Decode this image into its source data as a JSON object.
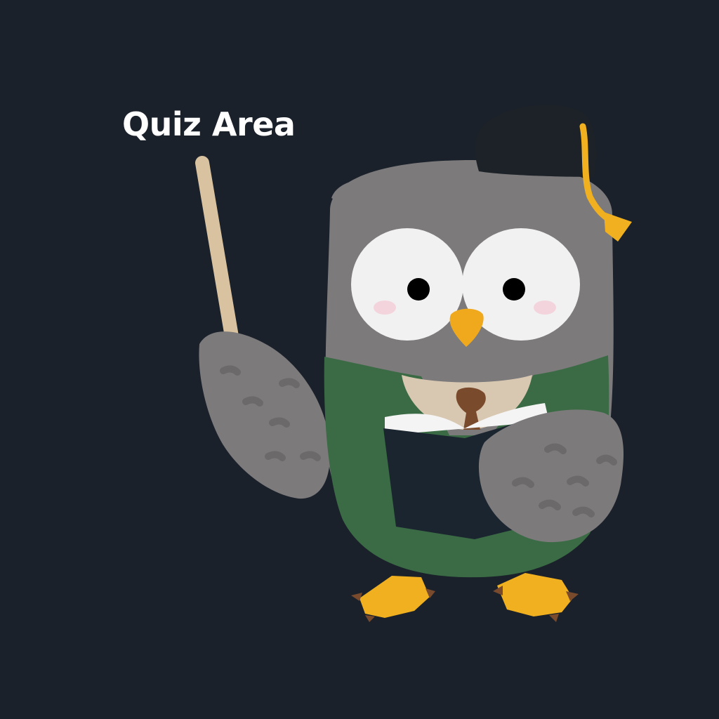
{
  "title": "Quiz Area",
  "colors": {
    "background": "#1a212b",
    "title_text": "#ffffff",
    "owl_gray": "#7c7a7b",
    "owl_gray_dark": "#6b696a",
    "eye_white": "#f2f1f2",
    "beak": "#f0a91c",
    "vest_green": "#3a6b44",
    "chest_beige": "#d8c8b2",
    "tie_brown": "#7a4a2c",
    "book_navy": "#1b2530",
    "page_white": "#f4f4f4",
    "pointer_tan": "#d9c29f",
    "feet_orange": "#f0b01f",
    "claw_brown": "#7a4a2c",
    "cap_black": "#1c2228",
    "tassel_gold": "#f0b01f"
  },
  "illustration": {
    "subject": "owl-teacher",
    "icons": [
      "graduation-cap-icon",
      "pointer-stick-icon",
      "book-icon"
    ]
  }
}
